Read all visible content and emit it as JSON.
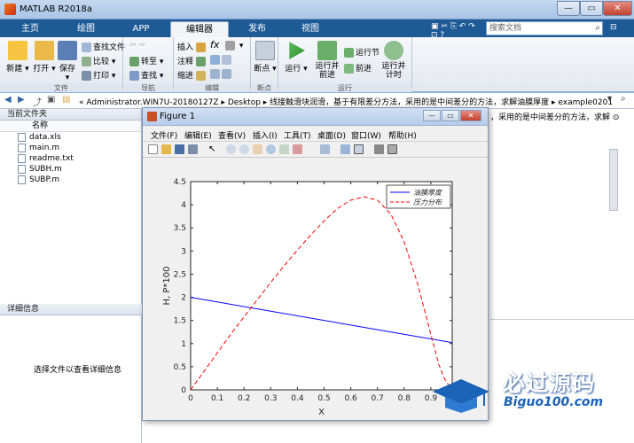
{
  "app": {
    "title": "MATLAB R2018a"
  },
  "tabs": [
    {
      "label": "主页"
    },
    {
      "label": "绘图"
    },
    {
      "label": "APP"
    },
    {
      "label": "编辑器"
    },
    {
      "label": "发布"
    },
    {
      "label": "视图"
    }
  ],
  "search": {
    "placeholder": "搜索文档"
  },
  "collapse_label": "⊟",
  "ribbon": {
    "file": {
      "new": "新建",
      "open": "打开",
      "save": "保存",
      "find_files": "查找文件",
      "compare": "比较",
      "print": "打印",
      "group": "文件"
    },
    "navigate": {
      "goto": "转至",
      "find": "查找",
      "group": "导航"
    },
    "edit": {
      "insert": "插入",
      "comment": "注释",
      "indent": "缩进",
      "fx": "fx",
      "group": "编辑"
    },
    "breakpoints": {
      "label": "断点",
      "group": "断点"
    },
    "run": {
      "run": "运行",
      "run_advance_1": "运行并",
      "run_advance_2": "前进",
      "run_section": "运行节",
      "advance": "前进",
      "run_time_1": "运行并",
      "run_time_2": "计时",
      "group": "运行"
    }
  },
  "address": {
    "path": "« Administrator.WIN7U-20180127Z ▸ Desktop ▸ 线接触滑块润滑，基于有限差分方法，采用的是中间差分的方法，求解油膜厚度 ▸ example0201"
  },
  "left_panel": {
    "header": "当前文件夹",
    "col_name": "名称",
    "files": [
      "data.xls",
      "main.m",
      "readme.txt",
      "SUBH.m",
      "SUBP.m"
    ],
    "detail_header": "详细信息",
    "detail_msg": "选择文件以查看详细信息"
  },
  "right_panel": {
    "cmd_text": "，采用的是中间差分的方法，求解 ⊙"
  },
  "figure": {
    "title": "Figure 1",
    "menus": [
      "文件(F)",
      "编辑(E)",
      "查看(V)",
      "插入(I)",
      "工具(T)",
      "桌面(D)",
      "窗口(W)",
      "帮助(H)"
    ]
  },
  "chart_data": {
    "type": "line",
    "xlabel": "X",
    "ylabel": "H, P*100",
    "xlim": [
      0,
      0.98
    ],
    "ylim": [
      0,
      4.5
    ],
    "xticks": [
      "0",
      "0.1",
      "0.2",
      "0.3",
      "0.4",
      "0.5",
      "0.6",
      "0.7",
      "0.8",
      "0.9"
    ],
    "yticks": [
      "0",
      "0.5",
      "1",
      "1.5",
      "2",
      "2.5",
      "3",
      "3.5",
      "4",
      "4.5"
    ],
    "legend_position": "top-right",
    "series": [
      {
        "name": "油膜厚度",
        "color": "#0000ff",
        "dash": "solid",
        "x": [
          0,
          0.98
        ],
        "y": [
          2.0,
          1.02
        ]
      },
      {
        "name": "压力分布",
        "color": "#ff0000",
        "dash": "dashed",
        "x": [
          0,
          0.05,
          0.1,
          0.15,
          0.2,
          0.25,
          0.3,
          0.35,
          0.4,
          0.45,
          0.5,
          0.55,
          0.6,
          0.65,
          0.7,
          0.75,
          0.8,
          0.85,
          0.9,
          0.93,
          0.95,
          0.97,
          0.98
        ],
        "y": [
          0,
          0.4,
          0.8,
          1.2,
          1.58,
          1.95,
          2.32,
          2.68,
          3.02,
          3.35,
          3.65,
          3.92,
          4.1,
          4.17,
          4.1,
          3.8,
          3.2,
          2.3,
          1.2,
          0.55,
          0.25,
          0.07,
          0
        ]
      }
    ]
  },
  "watermark": {
    "line1": "必过源码",
    "line2": "Biguo100.com"
  }
}
